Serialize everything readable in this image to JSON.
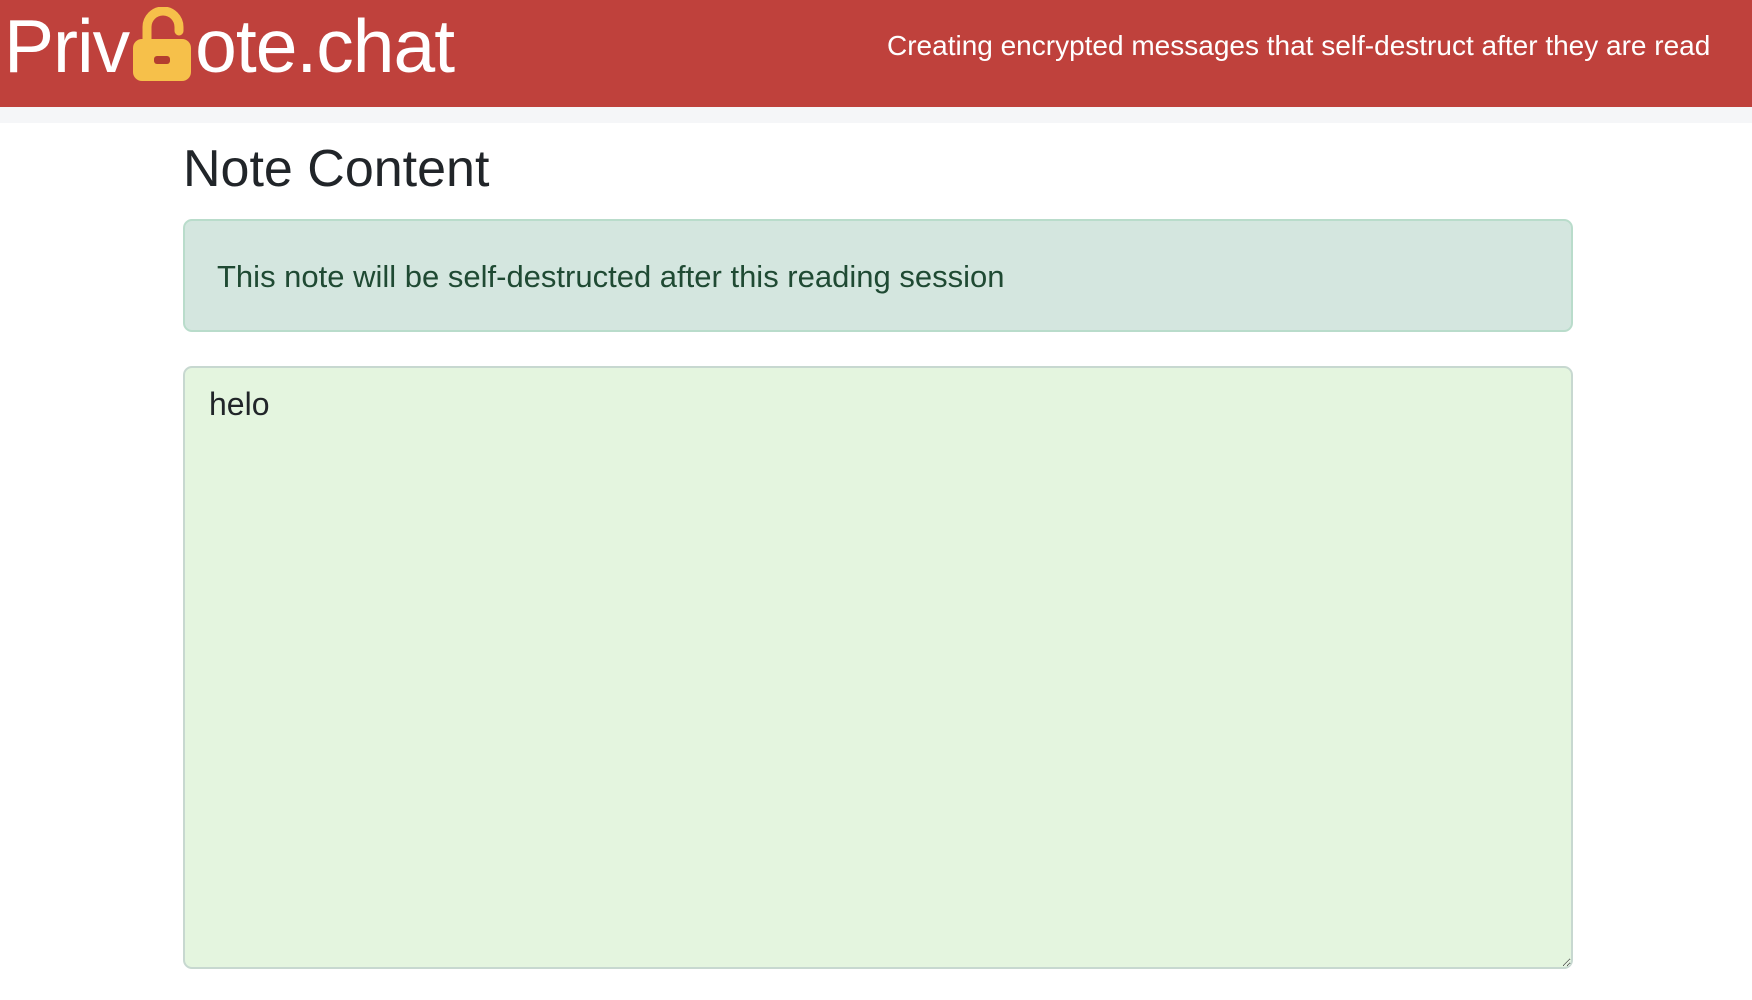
{
  "header": {
    "logo_prefix": "Priv",
    "logo_icon": "lock-open-icon",
    "logo_suffix": "ote.chat",
    "tagline": "Creating encrypted messages that self-destruct after they are read",
    "background_color": "#bf413c",
    "lock_color": "#f6c04a"
  },
  "main": {
    "title": "Note Content",
    "alert_text": "This note will be self-destructed after this reading session",
    "note_value": "helo",
    "alert_background": "#d4e6df",
    "note_background": "#e4f5df"
  }
}
